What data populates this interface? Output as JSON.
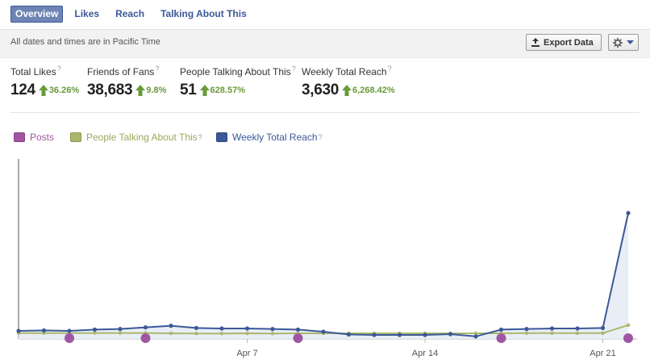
{
  "tabs": [
    {
      "label": "Overview",
      "active": true
    },
    {
      "label": "Likes",
      "active": false
    },
    {
      "label": "Reach",
      "active": false
    },
    {
      "label": "Talking About This",
      "active": false
    }
  ],
  "infobar": {
    "note": "All dates and times are in Pacific Time",
    "export_label": "Export Data",
    "export_icon": "upload-icon",
    "settings_icon": "gear-icon"
  },
  "stats": [
    {
      "label": "Total Likes",
      "value": "124",
      "change": "36.26%"
    },
    {
      "label": "Friends of Fans",
      "value": "38,683",
      "change": "9.8%"
    },
    {
      "label": "People Talking About This",
      "value": "51",
      "change": "628.57%"
    },
    {
      "label": "Weekly Total Reach",
      "value": "3,630",
      "change": "6,268.42%"
    }
  ],
  "help_mark": "?",
  "legend": {
    "posts": {
      "label": "Posts",
      "color": "#a057a3"
    },
    "talking": {
      "label": "People Talking About This",
      "color": "#aab86d"
    },
    "reach": {
      "label": "Weekly Total Reach",
      "color": "#3b5998"
    }
  },
  "chart_data": {
    "type": "line",
    "x_ticks": [
      {
        "label": "Apr 7",
        "index": 9
      },
      {
        "label": "Apr 14",
        "index": 16
      },
      {
        "label": "Apr 21",
        "index": 23
      }
    ],
    "series": [
      {
        "name": "Weekly Total Reach",
        "color": "#3b5998",
        "values": [
          30,
          33,
          30,
          38,
          42,
          52,
          62,
          48,
          45,
          45,
          42,
          38,
          25,
          8,
          5,
          5,
          5,
          10,
          -4,
          38,
          42,
          45,
          45,
          48,
          3630
        ]
      },
      {
        "name": "People Talking About This",
        "color": "#aab86d",
        "values": [
          1,
          1,
          1,
          2,
          2,
          2,
          0,
          -1,
          -1,
          0,
          -1,
          0,
          0,
          0,
          0,
          0,
          0,
          0,
          0,
          0,
          1,
          1,
          1,
          1,
          51
        ]
      },
      {
        "name": "Posts",
        "color": "#a057a3",
        "marker_indices": [
          2,
          5,
          11,
          19,
          24
        ]
      }
    ]
  }
}
